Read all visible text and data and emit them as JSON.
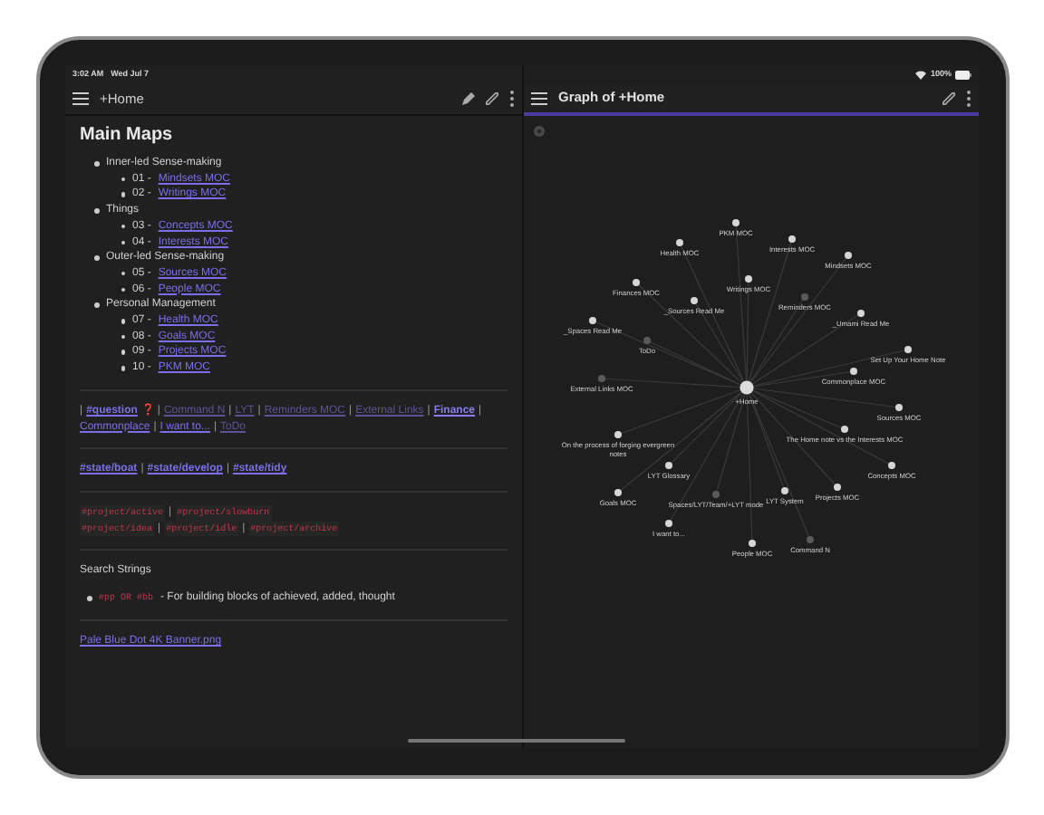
{
  "status_bar": {
    "time": "3:02 AM",
    "date": "Wed Jul 7",
    "battery": "100%"
  },
  "note": {
    "title": "+Home",
    "heading": "Main Maps",
    "outline": [
      {
        "text": "Inner-led Sense-making",
        "children": [
          {
            "number": "01 -",
            "link": "Mindsets MOC"
          },
          {
            "number": "02 -",
            "link": "Writings MOC"
          }
        ]
      },
      {
        "text": "Things",
        "children": [
          {
            "number": "03 -",
            "link": "Concepts MOC"
          },
          {
            "number": "04 -",
            "link": "Interests MOC"
          }
        ]
      },
      {
        "text": "Outer-led Sense-making",
        "children": [
          {
            "number": "05 -",
            "link": "Sources MOC"
          },
          {
            "number": "06 -",
            "link": "People MOC"
          }
        ]
      },
      {
        "text": "Personal Management",
        "children": [
          {
            "number": "07 -",
            "link": "Health MOC"
          },
          {
            "number": "08 -",
            "link": "Goals MOC"
          },
          {
            "number": "09 -",
            "link": "Projects MOC"
          },
          {
            "number": "10 -",
            "link": "PKM MOC"
          }
        ]
      }
    ],
    "sections": [
      {
        "kind": "links",
        "items": [
          {
            "kind": "sep",
            "text": "|"
          },
          {
            "kind": "tag",
            "text": "#question"
          },
          {
            "kind": "emoji",
            "text": "❓"
          },
          {
            "kind": "sep",
            "text": "|"
          },
          {
            "kind": "unresolved",
            "text": "Command N"
          },
          {
            "kind": "sep",
            "text": "|"
          },
          {
            "kind": "unresolved",
            "text": "LYT"
          },
          {
            "kind": "sep",
            "text": "|"
          },
          {
            "kind": "unresolved",
            "text": "Reminders MOC"
          },
          {
            "kind": "sep",
            "text": "|"
          },
          {
            "kind": "unresolved",
            "text": "External Links"
          },
          {
            "kind": "sep",
            "text": "|"
          },
          {
            "kind": "strong",
            "text": "Finance"
          },
          {
            "kind": "sep",
            "text": "|"
          },
          {
            "kind": "link",
            "text": "Commonplace"
          },
          {
            "kind": "sep",
            "text": "|"
          },
          {
            "kind": "link",
            "text": "I want to..."
          },
          {
            "kind": "sep",
            "text": "|"
          },
          {
            "kind": "unresolved",
            "text": "ToDo"
          }
        ]
      },
      {
        "kind": "links",
        "items": [
          {
            "kind": "tag",
            "text": "#state/boat"
          },
          {
            "kind": "sep",
            "text": "|"
          },
          {
            "kind": "tag",
            "text": "#state/develop"
          },
          {
            "kind": "sep",
            "text": "|"
          },
          {
            "kind": "tag",
            "text": "#state/tidy"
          }
        ]
      },
      {
        "kind": "links",
        "items": [
          {
            "kind": "code",
            "text": "#project/active"
          },
          {
            "kind": "sep",
            "text": "|"
          },
          {
            "kind": "code",
            "text": "#project/slowburn"
          },
          {
            "kind": "break"
          },
          {
            "kind": "code",
            "text": "#project/idea"
          },
          {
            "kind": "sep",
            "text": "|"
          },
          {
            "kind": "code",
            "text": "#project/idle"
          },
          {
            "kind": "sep",
            "text": "|"
          },
          {
            "kind": "code",
            "text": "#project/archive"
          }
        ]
      },
      {
        "kind": "search",
        "title": "Search Strings",
        "code": "#pp OR #bb",
        "text": "- For building blocks of achieved, added, thought"
      },
      {
        "kind": "embed",
        "text": "Pale Blue Dot 4K Banner.png"
      }
    ]
  },
  "graph": {
    "title": "Graph of +Home",
    "center": "+Home",
    "nodes": [
      {
        "label": "PKM MOC",
        "unresolved": false
      },
      {
        "label": "Health MOC",
        "unresolved": false
      },
      {
        "label": "Interests MOC",
        "unresolved": false
      },
      {
        "label": "Mindsets MOC",
        "unresolved": false
      },
      {
        "label": "Finances MOC",
        "unresolved": false
      },
      {
        "label": "Writings MOC",
        "unresolved": false
      },
      {
        "label": "_Sources Read Me",
        "unresolved": false
      },
      {
        "label": "Reminders MOC",
        "unresolved": true
      },
      {
        "label": "_Umami Read Me",
        "unresolved": false
      },
      {
        "label": "_Spaces Read Me",
        "unresolved": false
      },
      {
        "label": "ToDo",
        "unresolved": true
      },
      {
        "label": "Set Up Your Home Note",
        "unresolved": false
      },
      {
        "label": "Commonplace MOC",
        "unresolved": false
      },
      {
        "label": "External Links MOC",
        "unresolved": true
      },
      {
        "label": "Sources MOC",
        "unresolved": false
      },
      {
        "label": "The Home note vs the Interests MOC",
        "unresolved": false
      },
      {
        "label": "On the process of forging evergreen",
        "label_2": "notes",
        "unresolved": false
      },
      {
        "label": "LYT Glossary",
        "unresolved": false
      },
      {
        "label": "Concepts MOC",
        "unresolved": false
      },
      {
        "label": "Goals MOC",
        "unresolved": false
      },
      {
        "label": "Spaces/LYT/Team/+LYT mode",
        "unresolved": true
      },
      {
        "label": "LYT System",
        "unresolved": false
      },
      {
        "label": "Projects MOC",
        "unresolved": false
      },
      {
        "label": "I want to...",
        "unresolved": false
      },
      {
        "label": "People MOC",
        "unresolved": false
      },
      {
        "label": "Command N",
        "unresolved": true
      }
    ]
  }
}
